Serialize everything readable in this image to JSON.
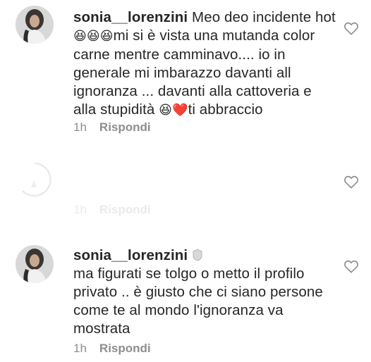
{
  "comments": [
    {
      "username": "sonia__lorenzini",
      "text_parts": [
        "Meo deo incidente hot",
        "😆😆😆",
        "mi si è vista una mutanda color carne mentre camminavo.... io in generale mi imbarazzo davanti all ignoranza ... davanti alla cattoveria e alla stupidità ",
        "😆❤️",
        "ti abbraccio"
      ],
      "time": "1h",
      "reply_label": "Rispondi"
    },
    {
      "username": "",
      "text": "",
      "time": "1h",
      "reply_label": "Rispondi"
    },
    {
      "username": "sonia__lorenzini",
      "text": "ma figurati se tolgo o metto il profilo privato .. è giusto che ci siano persone come te al mondo l'ignoranza va mostrata",
      "time": "1h",
      "reply_label": "Rispondi"
    }
  ],
  "colors": {
    "text": "#262626",
    "secondary": "#8e8e8e",
    "heart_outline": "#8e8e8e"
  },
  "icons": {
    "like": "heart-outline-icon",
    "verified": "verified-badge-icon"
  }
}
